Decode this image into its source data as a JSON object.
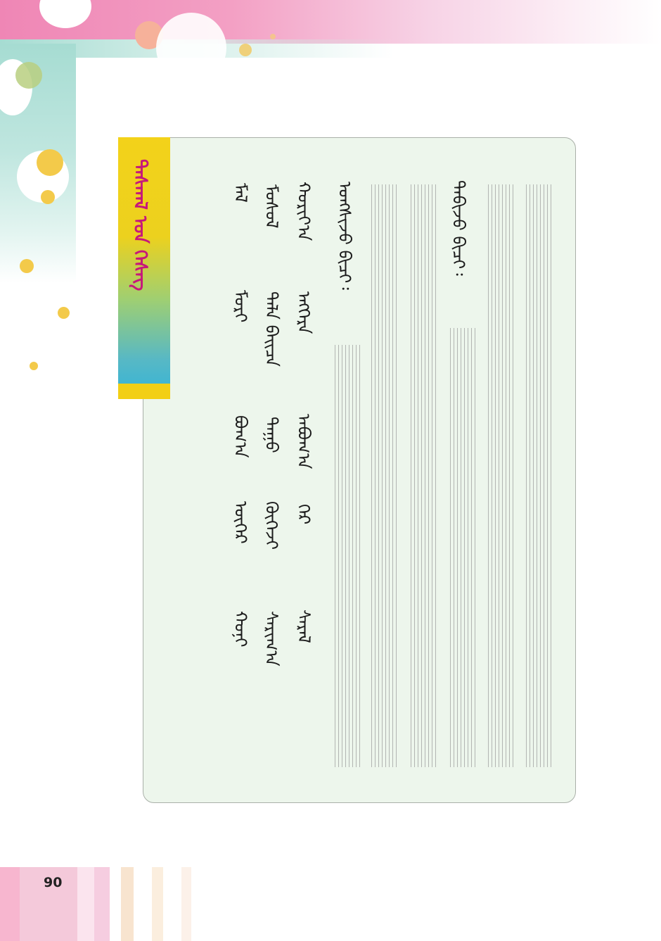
{
  "lesson": {
    "title": "ᠳᠠᠰᠬᠠᠯ ᠤᠨ ᠬᠡᠰᠡᠭ",
    "instruction_1": "ᠤᠩᠰᠢᠵᠤ ᠪᠢᠴᠢ᠄",
    "instruction_2": "ᠲᠠᠪᠢᠵᠤ ᠪᠢᠴᠢ᠄"
  },
  "word_columns": [
    {
      "words": [
        "ᠮᠠᠯ",
        "ᠮᠣᠷᠢ",
        "ᠪᠣᠬ᠎ᠠ",
        "ᠦᠬᠡᠷ",
        "ᠬᠣᠨᠢ"
      ]
    },
    {
      "words": [
        "ᠮᠣᠰᠣᠯ",
        "ᠲᠠᠯᠠ ᠪᠠᠢᠴᠠ",
        "ᠲᠠᠭᠤ",
        "ᠬᠥᠬᠡᠵᠢ",
        "ᠰᠠᠷᠢᠭ᠎ᠠ"
      ]
    },
    {
      "words": [
        "ᠬᠣᠷᠢᠶ᠎ᠠ",
        "ᠡᠩᠬᠡᠷᠡ",
        "ᠠᠪᠤᠭ᠎ᠠ",
        "ᠭᠡᠷ",
        "ᠰᠠᠷᠠᠯ"
      ]
    }
  ],
  "page_number": "90",
  "colors": {
    "panel_bg": "#edf6ec",
    "title_text": "#c6187b",
    "banner_top": "#f3d21a",
    "banner_bottom": "#33b4d9"
  }
}
